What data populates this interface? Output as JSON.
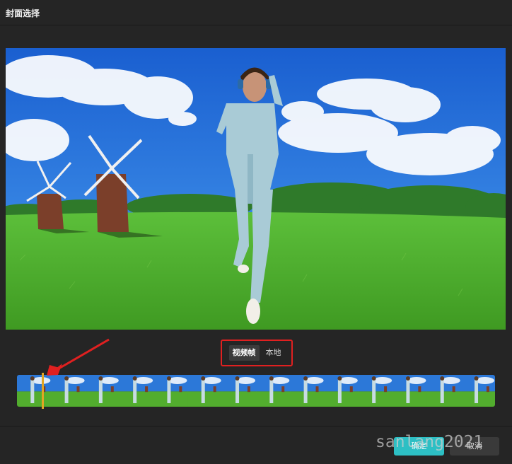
{
  "dialog": {
    "title": "封面选择"
  },
  "tabs": [
    {
      "label": "视频帧",
      "active": true
    },
    {
      "label": "本地",
      "active": false
    }
  ],
  "filmstrip": {
    "frame_count": 14,
    "playhead_position": 0.05
  },
  "footer": {
    "confirm_label": "确定",
    "cancel_label": "取消"
  },
  "watermark": "sanlang2021",
  "colors": {
    "accent": "#2dbfc4",
    "tab_highlight_border": "#e02020",
    "playhead": "#e2a524",
    "annotation_arrow": "#e02020",
    "background": "#252525"
  }
}
